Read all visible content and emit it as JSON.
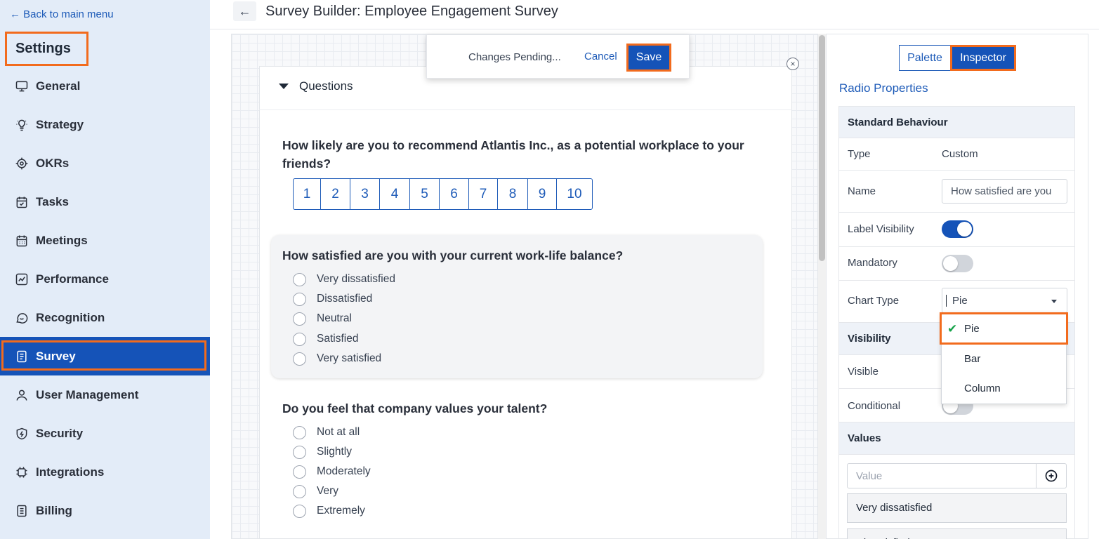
{
  "sidebar": {
    "back_link": "← Back to main menu",
    "title": "Settings",
    "items": [
      {
        "label": "General",
        "icon": "monitor-icon"
      },
      {
        "label": "Strategy",
        "icon": "lightbulb-icon"
      },
      {
        "label": "OKRs",
        "icon": "target-icon"
      },
      {
        "label": "Tasks",
        "icon": "calendar-check-icon"
      },
      {
        "label": "Meetings",
        "icon": "calendar-icon"
      },
      {
        "label": "Performance",
        "icon": "chart-line-icon"
      },
      {
        "label": "Recognition",
        "icon": "chat-smile-icon"
      },
      {
        "label": "Survey",
        "icon": "clipboard-list-icon",
        "active": true
      },
      {
        "label": "User Management",
        "icon": "user-icon"
      },
      {
        "label": "Security",
        "icon": "shield-icon"
      },
      {
        "label": "Integrations",
        "icon": "chip-icon"
      },
      {
        "label": "Billing",
        "icon": "document-icon"
      }
    ]
  },
  "header": {
    "back_icon": "←",
    "title": "Survey Builder: Employee Engagement Survey"
  },
  "pending": {
    "text": "Changes Pending...",
    "cancel_label": "Cancel",
    "save_label": "Save"
  },
  "form": {
    "section_label": "Questions",
    "close_icon": "×",
    "questions": [
      {
        "title": "How likely are you to recommend Atlantis Inc., as a potential workplace to your friends?",
        "scale": [
          "1",
          "2",
          "3",
          "4",
          "5",
          "6",
          "7",
          "8",
          "9",
          "10"
        ]
      },
      {
        "title": "How satisfied are you with your current work-life balance?",
        "options": [
          "Very dissatisfied",
          "Dissatisfied",
          "Neutral",
          "Satisfied",
          "Very satisfied"
        ]
      },
      {
        "title": "Do you feel that company values your talent?",
        "options": [
          "Not at all",
          "Slightly",
          "Moderately",
          "Very",
          "Extremely"
        ]
      }
    ]
  },
  "panel": {
    "tabs": {
      "palette": "Palette",
      "inspector": "Inspector"
    },
    "heading": "Radio Properties",
    "standard_section": "Standard Behaviour",
    "type_label": "Type",
    "type_value": "Custom",
    "name_label": "Name",
    "name_value": "How satisfied are you",
    "label_visibility_label": "Label Visibility",
    "label_visibility_on": true,
    "mandatory_label": "Mandatory",
    "mandatory_on": false,
    "chart_type_label": "Chart Type",
    "chart_type_value": "Pie",
    "chart_type_options": [
      "Pie",
      "Bar",
      "Column"
    ],
    "visibility_section": "Visibility",
    "visible_label": "Visible",
    "conditional_label": "Conditional",
    "values_section": "Values",
    "value_placeholder": "Value",
    "values": [
      "Very dissatisfied",
      "Dissatisfied"
    ]
  },
  "colors": {
    "accent": "#1553b8",
    "highlight": "#f26b1d",
    "sidebar_bg": "#e3ecf8"
  }
}
